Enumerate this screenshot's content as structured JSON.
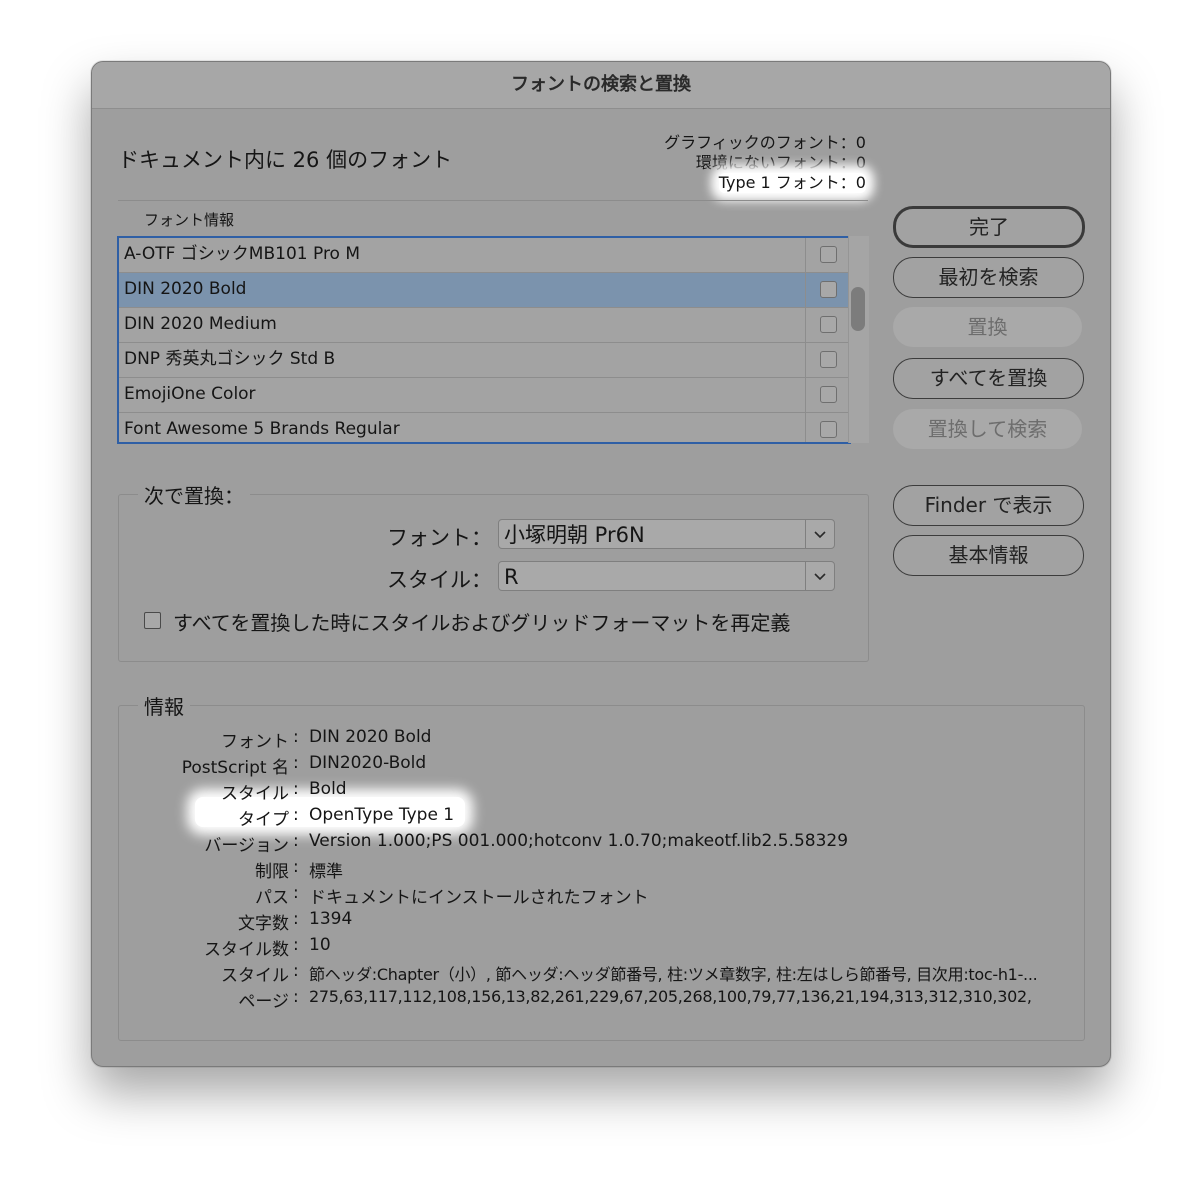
{
  "window": {
    "title": "フォントの検索と置換"
  },
  "summary": {
    "doc_fonts": "ドキュメント内に 26 個のフォント",
    "graphic_fonts": "グラフィックのフォント：0",
    "missing_fonts": "環境にないフォント：0",
    "type1_fonts": "Type 1 フォント：0"
  },
  "font_info_label": "フォント情報",
  "font_list": [
    {
      "name": "A-OTF ゴシックMB101 Pro M",
      "selected": false
    },
    {
      "name": "DIN 2020 Bold",
      "selected": true
    },
    {
      "name": "DIN 2020 Medium",
      "selected": false
    },
    {
      "name": "DNP 秀英丸ゴシック Std B",
      "selected": false
    },
    {
      "name": "EmojiOne Color",
      "selected": false
    },
    {
      "name": "Font Awesome 5 Brands Regular",
      "selected": false
    }
  ],
  "buttons": {
    "done": "完了",
    "find_first": "最初を検索",
    "replace": "置換",
    "replace_all": "すべてを置換",
    "replace_find": "置換して検索",
    "show_finder": "Finder で表示",
    "basic_info": "基本情報"
  },
  "replace_with": {
    "title": "次で置換：",
    "font_label": "フォント：",
    "font_value": "小塚明朝 Pr6N",
    "style_label": "スタイル：",
    "style_value": "R",
    "redefine_label": "すべてを置換した時にスタイルおよびグリッドフォーマットを再定義"
  },
  "info": {
    "title": "情報",
    "rows": [
      {
        "key": "フォント",
        "value": "DIN 2020 Bold"
      },
      {
        "key": "PostScript 名",
        "value": "DIN2020-Bold"
      },
      {
        "key": "スタイル",
        "value": "Bold"
      },
      {
        "key": "タイプ",
        "value": "OpenType Type 1"
      },
      {
        "key": "バージョン",
        "value": "Version 1.000;PS 001.000;hotconv 1.0.70;makeotf.lib2.5.58329"
      },
      {
        "key": "制限",
        "value": "標準"
      },
      {
        "key": "パス",
        "value": "ドキュメントにインストールされたフォント"
      },
      {
        "key": "文字数",
        "value": "1394"
      },
      {
        "key": "スタイル数",
        "value": "10"
      },
      {
        "key": "スタイル",
        "value": "節ヘッダ:Chapter（小）, 節ヘッダ:ヘッダ節番号, 柱:ツメ章数字, 柱:左はしら節番号, 目次用:toc-h1-..."
      },
      {
        "key": "ページ",
        "value": "275,63,117,112,108,156,13,82,261,229,67,205,268,100,79,77,136,21,194,313,312,310,302,"
      }
    ]
  },
  "colors": {
    "window_bg": "#9e9e9e",
    "selection": "#7b93ad",
    "focus_ring": "#2f5fa5"
  }
}
